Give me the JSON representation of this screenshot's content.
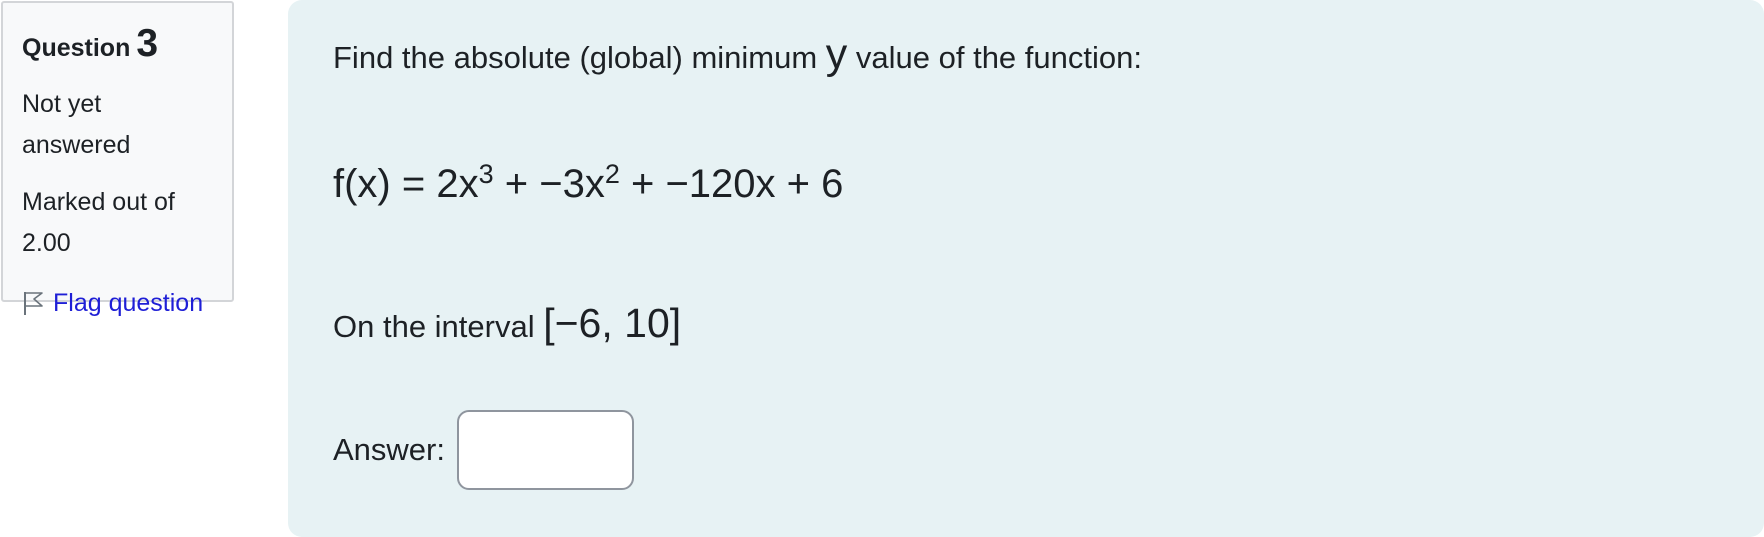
{
  "info": {
    "question_label": "Question",
    "question_number": "3",
    "state": "Not yet answered",
    "grade": "Marked out of 2.00",
    "flag_label": "Flag question"
  },
  "question": {
    "prompt_before": "Find the absolute (global) minimum ",
    "prompt_var": "y",
    "prompt_after": " value of the function:",
    "func_a": "f(x) = 2x",
    "func_exp1": "3",
    "func_b": " + −3x",
    "func_exp2": "2",
    "func_c": " + −120x + 6",
    "interval_label": "On the interval ",
    "interval_math": "[−6, 10]",
    "answer_label": "Answer:",
    "answer_value": ""
  },
  "colors": {
    "content_background": "#e7f2f4",
    "info_background": "#f8f9fa",
    "link": "#1f1fd6"
  }
}
